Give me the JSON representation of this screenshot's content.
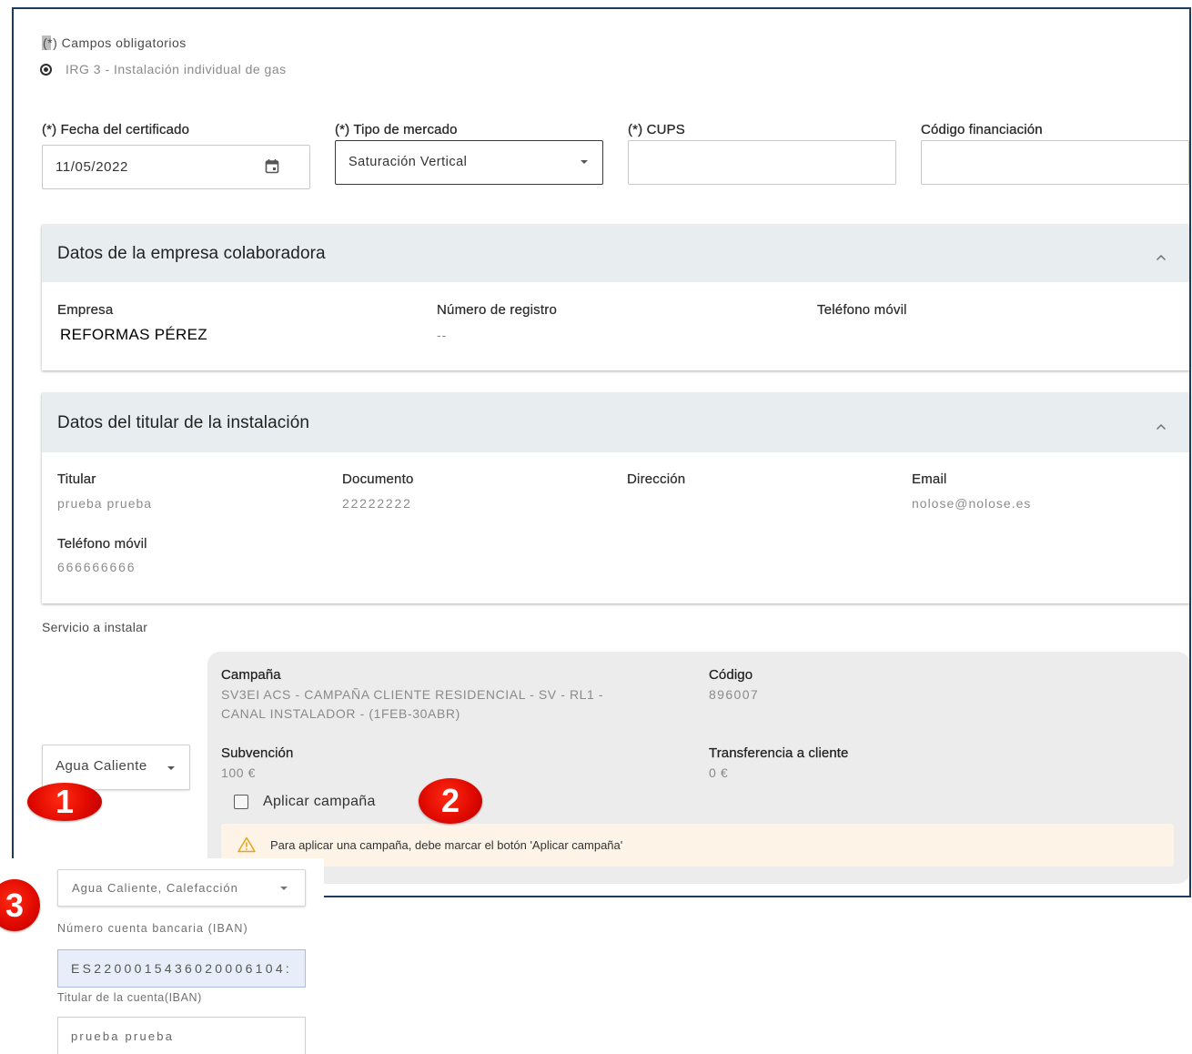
{
  "colors": {
    "frame_border": "#1d3b5c",
    "section_header_bg": "#e8eef0",
    "campaign_panel_bg": "#ececec",
    "warning_bg": "#fdf3e6",
    "warning_icon": "#e8a317",
    "badge_red": "#e10a00",
    "iban_field_bg": "#e8eef9"
  },
  "required_note": "(*) Campos obligatorios",
  "installation_type": {
    "label": "IRG 3 - Instalación individual de gas",
    "selected": true,
    "icon": "radio-selected-icon"
  },
  "certificate_form": {
    "date": {
      "label": "(*) Fecha del certificado",
      "value": "11/05/2022",
      "icon": "calendar-icon"
    },
    "market_type": {
      "label": "(*) Tipo de mercado",
      "value": "Saturación Vertical",
      "icon": "chevron-down-icon"
    },
    "cups": {
      "label": "(*) CUPS",
      "value": ""
    },
    "financing_code": {
      "label": "Código financiación",
      "value": ""
    }
  },
  "company_section": {
    "title": "Datos de la empresa colaboradora",
    "expanded": true,
    "toggle_icon": "chevron-up-icon",
    "company_label": "Empresa",
    "company_value": "REFORMAS PÉREZ",
    "registry_label": "Número de registro",
    "registry_value": "--",
    "mobile_label": "Teléfono móvil"
  },
  "holder_section": {
    "title": "Datos del titular de la instalación",
    "expanded": true,
    "toggle_icon": "chevron-up-icon",
    "holder_label": "Titular",
    "holder_value": "prueba prueba",
    "document_label": "Documento",
    "document_value": "22222222",
    "address_label": "Dirección",
    "email_label": "Email",
    "email_value": "nolose@nolose.es",
    "mobile_label": "Teléfono móvil",
    "mobile_value": "666666666"
  },
  "service": {
    "label": "Servicio a instalar",
    "selected": "Agua Caliente"
  },
  "campaign": {
    "campaign_label": "Campaña",
    "campaign_value_lines": [
      "SV3EI ACS - CAMPAÑA CLIENTE RESIDENCIAL - SV - RL1 -",
      "CANAL INSTALADOR - (1FEB-30ABR)"
    ],
    "code_label": "Código",
    "code_value": "896007",
    "subsidy_label": "Subvención",
    "subsidy_value": "100 €",
    "transfer_label": "Transferencia a cliente",
    "transfer_value": "0 €",
    "apply_label": "Aplicar campaña",
    "apply_checked": false,
    "warning": "Para aplicar una campaña, debe marcar el botón 'Aplicar campaña'",
    "warning_icon": "warning-icon"
  },
  "inset_panel": {
    "service_selected": "Agua Caliente, Calefacción",
    "iban_label": "Número cuenta bancaria (IBAN)",
    "iban_value": "ES2200015436020006104:",
    "account_holder_label": "Titular de la cuenta(IBAN)",
    "account_holder_value": "prueba prueba"
  },
  "annotations": [
    "1",
    "2",
    "3"
  ]
}
